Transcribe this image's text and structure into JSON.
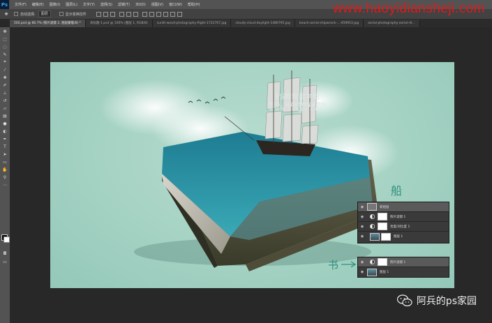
{
  "app": {
    "logo": "Ps"
  },
  "menu": [
    "文件(F)",
    "编辑(E)",
    "图像(I)",
    "图层(L)",
    "文字(Y)",
    "选择(S)",
    "滤镜(T)",
    "3D(D)",
    "视图(V)",
    "窗口(W)",
    "帮助(H)"
  ],
  "options": {
    "auto_select_label": "自动选择:",
    "auto_select_value": "图层",
    "transform_controls_label": "显示变换控件"
  },
  "site_watermark": "www.haoyidiansheji.com",
  "tabs": [
    {
      "label": "502.psd @ 66.7% (照片滤镜 2, 图层蒙版/8) *",
      "active": true
    },
    {
      "label": "未标题-1.psd @ 100% (图层 1, RGB/8)",
      "active": false
    },
    {
      "label": "sunlit-wood-photography-flight-1722767.jpg",
      "active": false
    },
    {
      "label": "cloudy-cloud-daylight-1486795.jpg",
      "active": false
    },
    {
      "label": "beach-aerial-shipwreck-...-459913.jpg",
      "active": false
    },
    {
      "label": "aerial-photography-aerial-dr...",
      "active": false
    }
  ],
  "tools": [
    "move-icon",
    "marquee-icon",
    "lasso-icon",
    "quick-select-icon",
    "crop-icon",
    "eyedropper-icon",
    "healing-icon",
    "brush-icon",
    "stamp-icon",
    "history-brush-icon",
    "eraser-icon",
    "gradient-icon",
    "blur-icon",
    "dodge-icon",
    "pen-icon",
    "type-icon",
    "path-select-icon",
    "shape-icon",
    "hand-icon",
    "zoom-icon",
    "more-icon"
  ],
  "art_watermark": {
    "line1": "PS教程自学网",
    "line2": "学PS，就到PS教程自学网",
    "line3": "WWW.16XX8.COM"
  },
  "annotations": {
    "ship": "船",
    "book": "书"
  },
  "layers_ship": [
    {
      "name": "新组层",
      "type": "group",
      "selected": true
    },
    {
      "name": "照片滤镜 1",
      "type": "adjustment",
      "selected": false
    },
    {
      "name": "亮度/对比度 1",
      "type": "adjustment",
      "selected": false
    },
    {
      "name": "图层 1",
      "type": "image",
      "selected": false
    }
  ],
  "layers_book": [
    {
      "name": "照片滤镜 1",
      "type": "adjustment",
      "selected": true
    },
    {
      "name": "图层 1",
      "type": "image",
      "selected": false
    }
  ],
  "wechat_mark": "阿兵的ps家园",
  "colors": {
    "site_watermark": "#e01a1a",
    "canvas_bg": "#a6d3c4",
    "annotation": "#2e8f7d"
  }
}
